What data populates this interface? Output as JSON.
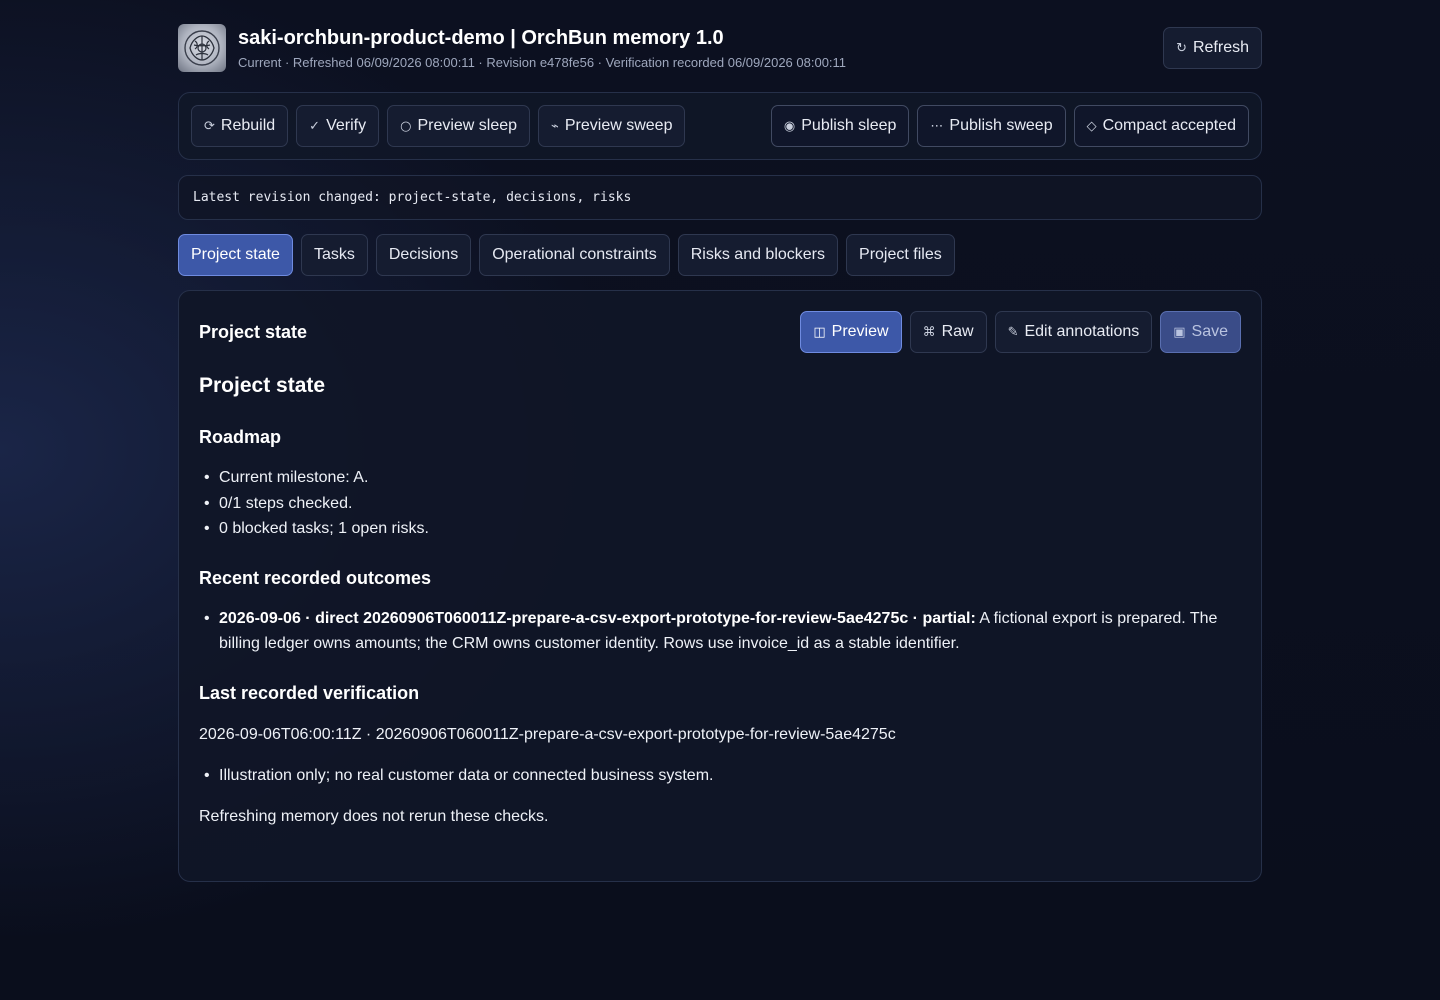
{
  "header": {
    "title": "saki-orchbun-product-demo | OrchBun memory 1.0",
    "subtitle": "Current · Refreshed 06/09/2026 08:00:11 · Revision e478fe56 · Verification recorded 06/09/2026 08:00:11",
    "refresh": {
      "icon": "↻",
      "label": "Refresh"
    }
  },
  "toolbar": {
    "left": [
      {
        "icon": "⟳",
        "label": "Rebuild"
      },
      {
        "icon": "✓",
        "label": "Verify"
      },
      {
        "icon": "○",
        "label": "Preview sleep"
      },
      {
        "icon": "⌁",
        "label": "Preview sweep"
      }
    ],
    "right": [
      {
        "icon": "◉",
        "label": "Publish sleep"
      },
      {
        "icon": "⋯",
        "label": "Publish sweep"
      },
      {
        "icon": "◇",
        "label": "Compact accepted"
      }
    ]
  },
  "revision_text": "Latest revision changed: project-state, decisions, risks",
  "tabs": [
    "Project state",
    "Tasks",
    "Decisions",
    "Operational constraints",
    "Risks and blockers",
    "Project files"
  ],
  "active_tab": "Project state",
  "panel": {
    "title": "Project state",
    "actions": {
      "preview": {
        "icon": "◫",
        "label": "Preview"
      },
      "raw": {
        "icon": "⌘",
        "label": "Raw"
      },
      "edit": {
        "icon": "✎",
        "label": "Edit annotations"
      },
      "save": {
        "icon": "▣",
        "label": "Save"
      }
    }
  },
  "document": {
    "h1": "Project state",
    "roadmap": {
      "heading": "Roadmap",
      "items": [
        "Current milestone: A.",
        "0/1 steps checked.",
        "0 blocked tasks; 1 open risks."
      ]
    },
    "outcomes": {
      "heading": "Recent recorded outcomes",
      "item_bold": "2026-09-06 · direct 20260906T060011Z-prepare-a-csv-export-prototype-for-review-5ae4275c · partial:",
      "item_text": " A fictional export is prepared. The billing ledger owns amounts; the CRM owns customer identity. Rows use invoice_id as a stable identifier."
    },
    "verification": {
      "heading": "Last recorded verification",
      "line": "2026-09-06T06:00:11Z · 20260906T060011Z-prepare-a-csv-export-prototype-for-review-5ae4275c",
      "items": [
        "Illustration only; no real customer data or connected business system."
      ],
      "note": "Refreshing memory does not rerun these checks."
    }
  },
  "colors": {
    "accent": "#3d58a8",
    "accent_border": "#6f8be0",
    "background": "#0c1020",
    "surface": "#151c30",
    "border": "#2f3850"
  }
}
